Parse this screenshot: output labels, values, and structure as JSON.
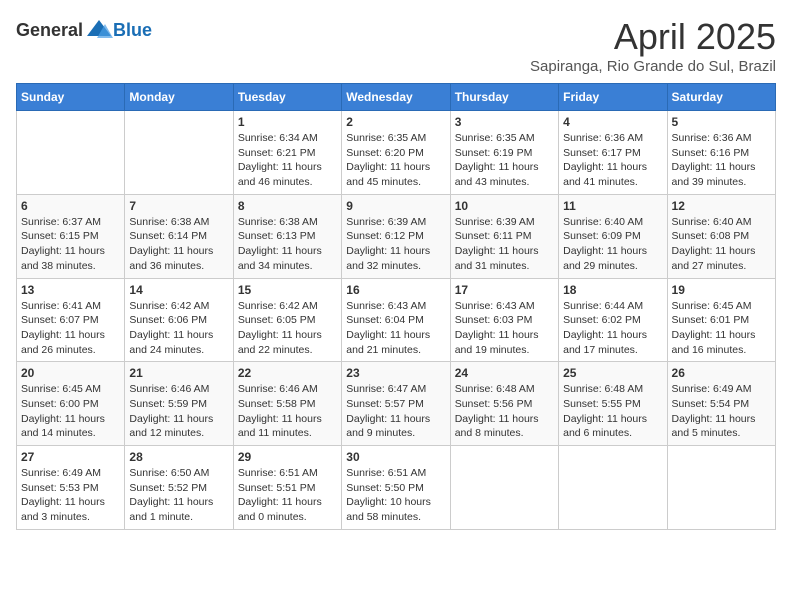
{
  "logo": {
    "general": "General",
    "blue": "Blue"
  },
  "header": {
    "month": "April 2025",
    "location": "Sapiranga, Rio Grande do Sul, Brazil"
  },
  "weekdays": [
    "Sunday",
    "Monday",
    "Tuesday",
    "Wednesday",
    "Thursday",
    "Friday",
    "Saturday"
  ],
  "weeks": [
    [
      {
        "day": "",
        "info": ""
      },
      {
        "day": "",
        "info": ""
      },
      {
        "day": "1",
        "info": "Sunrise: 6:34 AM\nSunset: 6:21 PM\nDaylight: 11 hours and 46 minutes."
      },
      {
        "day": "2",
        "info": "Sunrise: 6:35 AM\nSunset: 6:20 PM\nDaylight: 11 hours and 45 minutes."
      },
      {
        "day": "3",
        "info": "Sunrise: 6:35 AM\nSunset: 6:19 PM\nDaylight: 11 hours and 43 minutes."
      },
      {
        "day": "4",
        "info": "Sunrise: 6:36 AM\nSunset: 6:17 PM\nDaylight: 11 hours and 41 minutes."
      },
      {
        "day": "5",
        "info": "Sunrise: 6:36 AM\nSunset: 6:16 PM\nDaylight: 11 hours and 39 minutes."
      }
    ],
    [
      {
        "day": "6",
        "info": "Sunrise: 6:37 AM\nSunset: 6:15 PM\nDaylight: 11 hours and 38 minutes."
      },
      {
        "day": "7",
        "info": "Sunrise: 6:38 AM\nSunset: 6:14 PM\nDaylight: 11 hours and 36 minutes."
      },
      {
        "day": "8",
        "info": "Sunrise: 6:38 AM\nSunset: 6:13 PM\nDaylight: 11 hours and 34 minutes."
      },
      {
        "day": "9",
        "info": "Sunrise: 6:39 AM\nSunset: 6:12 PM\nDaylight: 11 hours and 32 minutes."
      },
      {
        "day": "10",
        "info": "Sunrise: 6:39 AM\nSunset: 6:11 PM\nDaylight: 11 hours and 31 minutes."
      },
      {
        "day": "11",
        "info": "Sunrise: 6:40 AM\nSunset: 6:09 PM\nDaylight: 11 hours and 29 minutes."
      },
      {
        "day": "12",
        "info": "Sunrise: 6:40 AM\nSunset: 6:08 PM\nDaylight: 11 hours and 27 minutes."
      }
    ],
    [
      {
        "day": "13",
        "info": "Sunrise: 6:41 AM\nSunset: 6:07 PM\nDaylight: 11 hours and 26 minutes."
      },
      {
        "day": "14",
        "info": "Sunrise: 6:42 AM\nSunset: 6:06 PM\nDaylight: 11 hours and 24 minutes."
      },
      {
        "day": "15",
        "info": "Sunrise: 6:42 AM\nSunset: 6:05 PM\nDaylight: 11 hours and 22 minutes."
      },
      {
        "day": "16",
        "info": "Sunrise: 6:43 AM\nSunset: 6:04 PM\nDaylight: 11 hours and 21 minutes."
      },
      {
        "day": "17",
        "info": "Sunrise: 6:43 AM\nSunset: 6:03 PM\nDaylight: 11 hours and 19 minutes."
      },
      {
        "day": "18",
        "info": "Sunrise: 6:44 AM\nSunset: 6:02 PM\nDaylight: 11 hours and 17 minutes."
      },
      {
        "day": "19",
        "info": "Sunrise: 6:45 AM\nSunset: 6:01 PM\nDaylight: 11 hours and 16 minutes."
      }
    ],
    [
      {
        "day": "20",
        "info": "Sunrise: 6:45 AM\nSunset: 6:00 PM\nDaylight: 11 hours and 14 minutes."
      },
      {
        "day": "21",
        "info": "Sunrise: 6:46 AM\nSunset: 5:59 PM\nDaylight: 11 hours and 12 minutes."
      },
      {
        "day": "22",
        "info": "Sunrise: 6:46 AM\nSunset: 5:58 PM\nDaylight: 11 hours and 11 minutes."
      },
      {
        "day": "23",
        "info": "Sunrise: 6:47 AM\nSunset: 5:57 PM\nDaylight: 11 hours and 9 minutes."
      },
      {
        "day": "24",
        "info": "Sunrise: 6:48 AM\nSunset: 5:56 PM\nDaylight: 11 hours and 8 minutes."
      },
      {
        "day": "25",
        "info": "Sunrise: 6:48 AM\nSunset: 5:55 PM\nDaylight: 11 hours and 6 minutes."
      },
      {
        "day": "26",
        "info": "Sunrise: 6:49 AM\nSunset: 5:54 PM\nDaylight: 11 hours and 5 minutes."
      }
    ],
    [
      {
        "day": "27",
        "info": "Sunrise: 6:49 AM\nSunset: 5:53 PM\nDaylight: 11 hours and 3 minutes."
      },
      {
        "day": "28",
        "info": "Sunrise: 6:50 AM\nSunset: 5:52 PM\nDaylight: 11 hours and 1 minute."
      },
      {
        "day": "29",
        "info": "Sunrise: 6:51 AM\nSunset: 5:51 PM\nDaylight: 11 hours and 0 minutes."
      },
      {
        "day": "30",
        "info": "Sunrise: 6:51 AM\nSunset: 5:50 PM\nDaylight: 10 hours and 58 minutes."
      },
      {
        "day": "",
        "info": ""
      },
      {
        "day": "",
        "info": ""
      },
      {
        "day": "",
        "info": ""
      }
    ]
  ]
}
